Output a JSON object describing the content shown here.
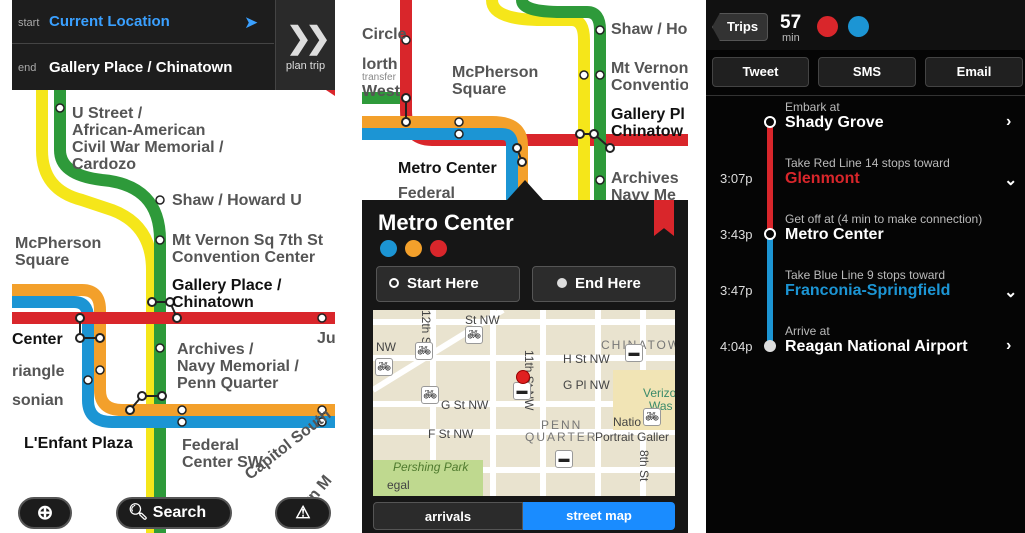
{
  "panel1": {
    "start_label": "start",
    "start_value": "Current Location",
    "end_label": "end",
    "end_value": "Gallery Place / Chinatown",
    "plan_label": "plan trip",
    "stations": {
      "ustreet": "U Street /",
      "ustreet2": "African-American",
      "ustreet3": "Civil War Memorial /",
      "ustreet4": "Cardozo",
      "shaw": "Shaw / Howard U",
      "mcpherson": "McPherson",
      "mcpherson2": "Square",
      "mtvernon": "Mt Vernon Sq 7th St",
      "mtvernon2": "Convention Center",
      "gallery": "Gallery Place /",
      "gallery2": "Chinatown",
      "center": "Center",
      "ju": "Ju",
      "archives": "Archives /",
      "archives2": "Navy Memorial /",
      "archives3": "Penn Quarter",
      "triangle": "riangle",
      "sonian": "sonian",
      "lenfant": "L'Enfant Plaza",
      "federal": "Federal",
      "federal2": "Center SW",
      "capitol": "Capitol South",
      "eastern": "ern M"
    },
    "search_label": "Search"
  },
  "panel2": {
    "stations": {
      "circle": "Circle",
      "north": "lorth",
      "transfer": "transfer",
      "west": "West",
      "mcpherson": "McPherson",
      "mcpherson2": "Square",
      "shaw": "Shaw / Ho",
      "mtvernon": "Mt Vernon",
      "mtvernon2": "Conventio",
      "gallery": "Gallery Pl",
      "gallery2": "Chinatow",
      "metrocenter": "Metro Center",
      "archives": "Archives",
      "navy": "Navy Me",
      "federal": "Federal"
    },
    "popup_title": "Metro Center",
    "line_colors": [
      "#1c95d4",
      "#f3a02b",
      "#d9262b"
    ],
    "start_button": "Start Here",
    "end_button": "End Here",
    "map_labels": {
      "st_nw_top": "St NW",
      "nw": "NW",
      "chinatown": "CHINATOWN",
      "h_st": "H St NW",
      "g_pl": "G Pl NW",
      "g_st": "G St NW",
      "f_st": "F St NW",
      "penn": "PENN",
      "quarter": "QUARTER",
      "portrait": "Portrait Galler",
      "eleventh": "11th St NW",
      "twelfth": "12th St",
      "eighth": "8th St",
      "verizon": "Verizo",
      "was": "Was",
      "natio": "Natio",
      "pershing": "Pershing Park",
      "eagle": "egal"
    },
    "tab_arrivals": "arrivals",
    "tab_street_map": "street map"
  },
  "panel3": {
    "trips_button": "Trips",
    "duration_value": "57",
    "duration_unit": "min",
    "line_dots": [
      "#d9262b",
      "#1c95d4"
    ],
    "tweet": "Tweet",
    "sms": "SMS",
    "email": "Email",
    "steps": [
      {
        "caption": "Embark at",
        "title": "Shady Grove",
        "time": ""
      },
      {
        "caption": "Take Red Line 14 stops toward",
        "title": "Glenmont",
        "time": "3:07p"
      },
      {
        "caption": "Get off at (4 min to make connection)",
        "title": "Metro Center",
        "time": "3:43p"
      },
      {
        "caption": "Take Blue Line 9 stops toward",
        "title": "Franconia-Springfield",
        "time": "3:47p"
      },
      {
        "caption": "Arrive at",
        "title": "Reagan National Airport",
        "time": "4:04p"
      }
    ],
    "colors": {
      "red": "#d9262b",
      "blue": "#1c95d4"
    }
  }
}
